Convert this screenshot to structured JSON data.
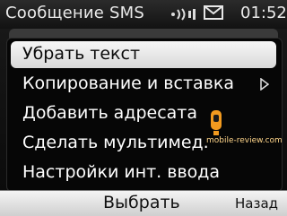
{
  "status_bar": {
    "title": "Сообщение SMS",
    "time": "01:52",
    "icons": [
      "signal-icon",
      "envelope-icon"
    ]
  },
  "menu": {
    "items": [
      {
        "label": "Убрать текст",
        "selected": true
      },
      {
        "label": "Копирование и вставка",
        "has_submenu": true
      },
      {
        "label": "Добавить адресата"
      },
      {
        "label": "Сделать мультимед."
      },
      {
        "label": "Настройки инт. ввода"
      }
    ]
  },
  "softkeys": {
    "center": "Выбрать",
    "right": "Назад"
  },
  "colors": {
    "selection": "#e8e8e8",
    "menu_bg": "#060606",
    "watermark": "#f29a1f"
  }
}
